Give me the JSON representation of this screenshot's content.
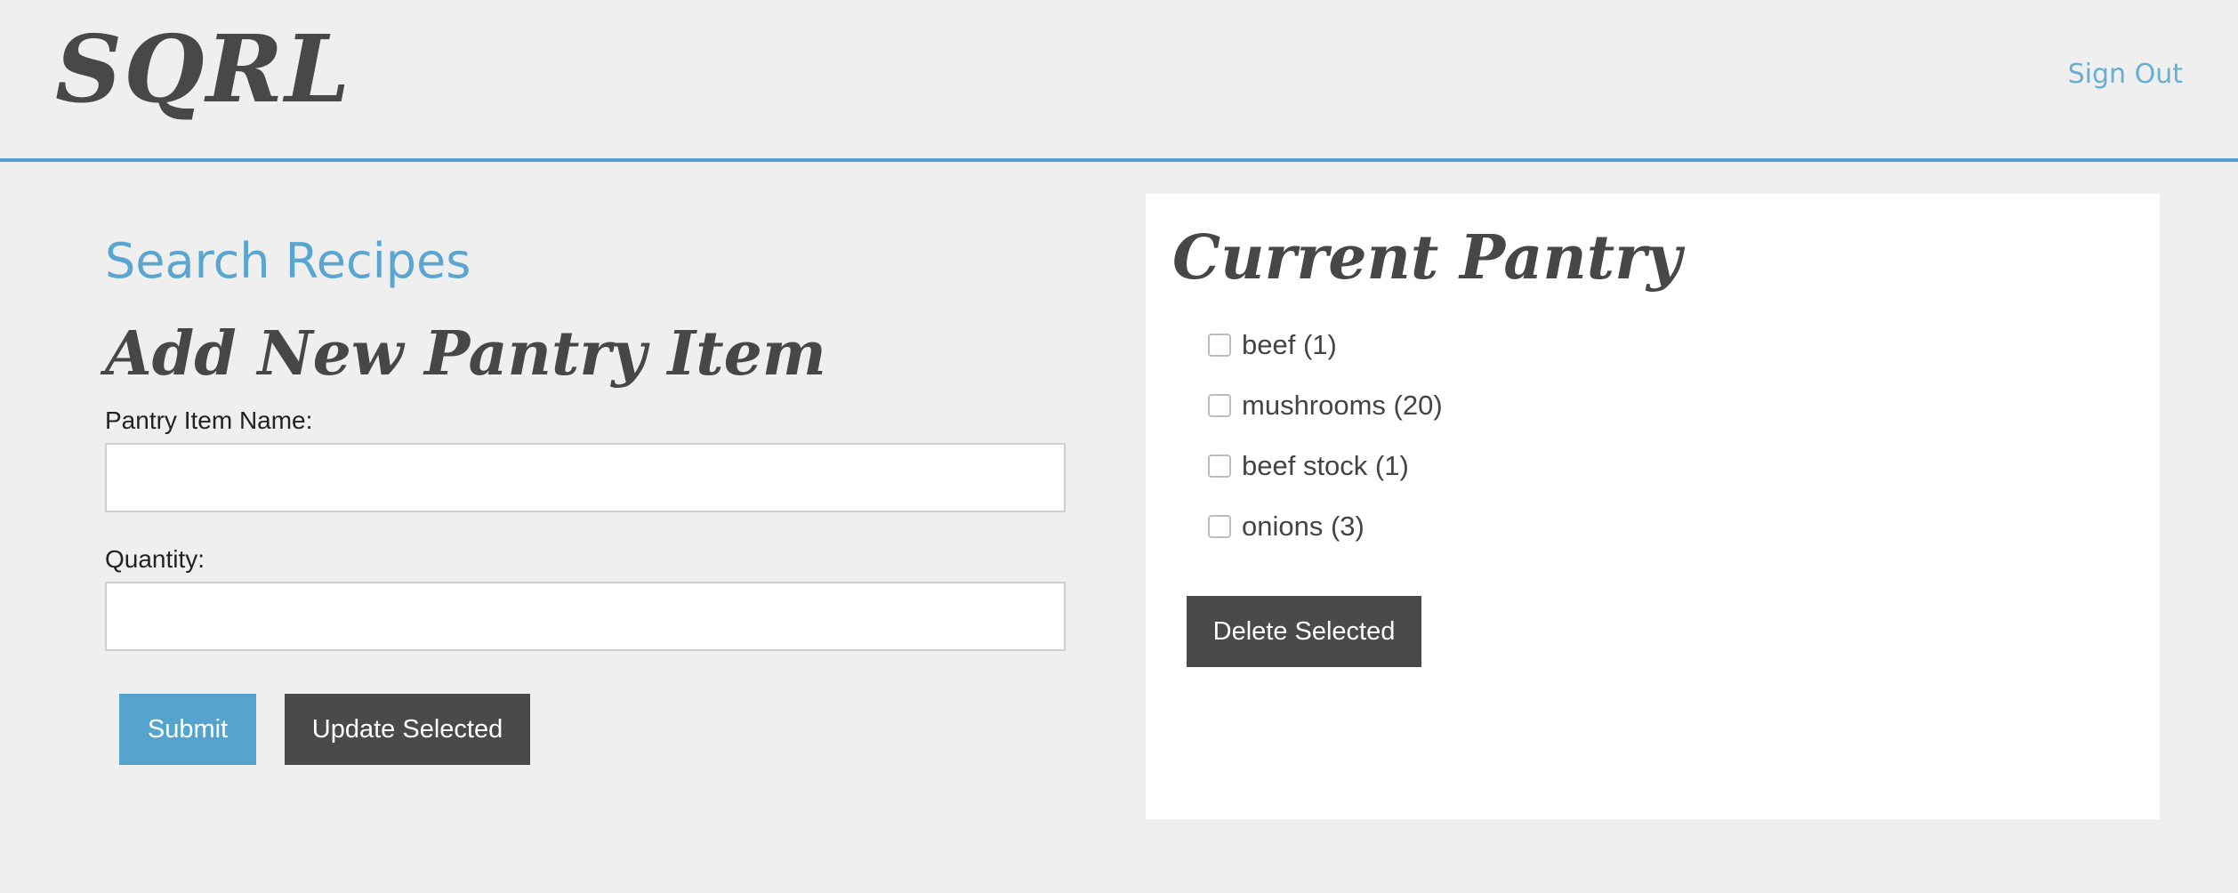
{
  "header": {
    "logo": "SQRL",
    "sign_out": "Sign Out"
  },
  "search_link": "Search Recipes",
  "add_form": {
    "title": "Add New Pantry Item",
    "name_label": "Pantry Item Name:",
    "name_value": "",
    "quantity_label": "Quantity:",
    "quantity_value": "",
    "submit_label": "Submit",
    "update_label": "Update Selected"
  },
  "pantry": {
    "title": "Current Pantry",
    "items": [
      {
        "label": "beef (1)",
        "checked": false
      },
      {
        "label": "mushrooms (20)",
        "checked": false
      },
      {
        "label": "beef stock (1)",
        "checked": false
      },
      {
        "label": "onions (3)",
        "checked": false
      }
    ],
    "delete_label": "Delete Selected"
  },
  "colors": {
    "accent": "#4f9fc8",
    "dark_button": "#4a4b48",
    "background": "#efefef"
  }
}
